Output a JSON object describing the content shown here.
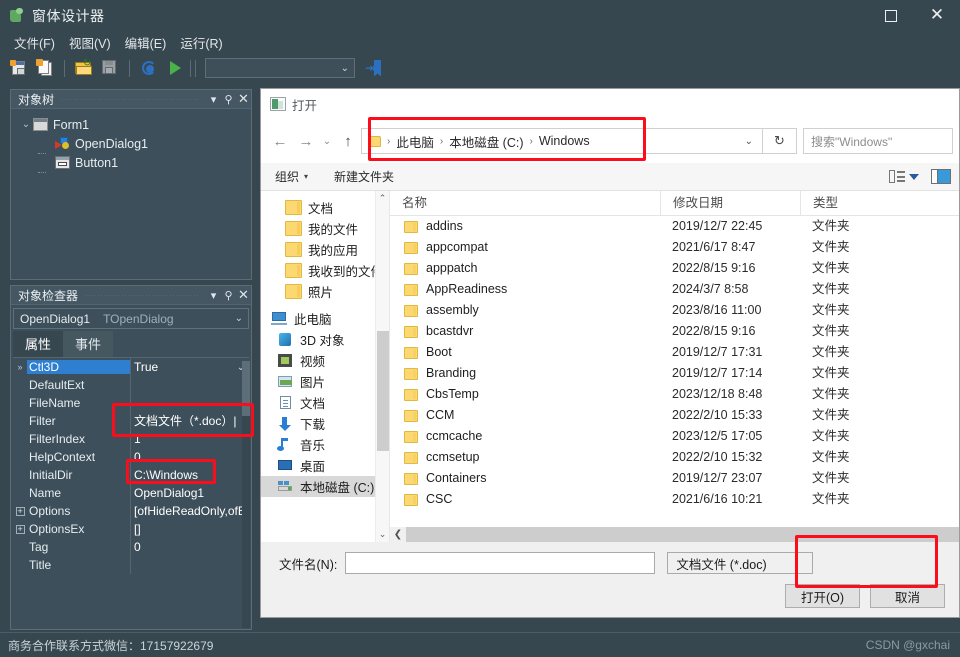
{
  "ide": {
    "title": "窗体设计器",
    "window_buttons": {
      "maximize": "▢",
      "close": "✕"
    },
    "menus": [
      "文件(F)",
      "视图(V)",
      "编辑(E)",
      "运行(R)"
    ],
    "toolbar": {
      "combo_value": "",
      "icons": [
        "new-form-icon",
        "copy-file-icon",
        "open-file-icon",
        "save-file-icon",
        "debug-icon",
        "run-icon",
        "goto-implementation-icon"
      ]
    },
    "statusbar": {
      "text": "商务合作联系方式微信：17157922679"
    },
    "watermark": "CSDN @gxchai"
  },
  "object_tree": {
    "title": "对象树",
    "header_buttons": [
      "▾",
      "⚲",
      "✕"
    ],
    "nodes": [
      {
        "label": "Form1",
        "icon": "form-icon",
        "level": 0,
        "expanded": true
      },
      {
        "label": "OpenDialog1",
        "icon": "open-dialog-icon",
        "level": 1
      },
      {
        "label": "Button1",
        "icon": "button-icon",
        "level": 1
      }
    ]
  },
  "object_inspector": {
    "title": "对象检查器",
    "header_buttons": [
      "▾",
      "⚲",
      "✕"
    ],
    "selector": {
      "object": "OpenDialog1",
      "class": "TOpenDialog"
    },
    "tabs": [
      {
        "label": "属性",
        "active": true
      },
      {
        "label": "事件",
        "active": false
      }
    ],
    "properties": [
      {
        "name": "Ctl3D",
        "value": "True",
        "gutter": "»",
        "selected": true,
        "dropdown": true
      },
      {
        "name": "DefaultExt",
        "value": "",
        "gutter": ""
      },
      {
        "name": "FileName",
        "value": "",
        "gutter": ""
      },
      {
        "name": "Filter",
        "value": "文档文件（*.doc）|",
        "gutter": ""
      },
      {
        "name": "FilterIndex",
        "value": "1",
        "gutter": ""
      },
      {
        "name": "HelpContext",
        "value": "0",
        "gutter": ""
      },
      {
        "name": "InitialDir",
        "value": "C:\\Windows",
        "gutter": ""
      },
      {
        "name": "Name",
        "value": "OpenDialog1",
        "gutter": ""
      },
      {
        "name": "Options",
        "value": "[ofHideReadOnly,ofEnal",
        "gutter": "+"
      },
      {
        "name": "OptionsEx",
        "value": "[]",
        "gutter": "+"
      },
      {
        "name": "Tag",
        "value": "0",
        "gutter": ""
      },
      {
        "name": "Title",
        "value": "",
        "gutter": ""
      }
    ]
  },
  "open_dialog": {
    "title": "打开",
    "nav": {
      "back": "←",
      "forward": "→",
      "history": "⌄",
      "up": "↑",
      "breadcrumb": [
        "此电脑",
        "本地磁盘 (C:)",
        "Windows"
      ],
      "breadcrumb_separator": "›",
      "breadcrumb_chevron": "⌄",
      "refresh": "↻",
      "search_placeholder": "搜索\"Windows\""
    },
    "command_bar": {
      "organize": "组织",
      "organize_caret": "▾",
      "new_folder": "新建文件夹",
      "view_caret": "▾"
    },
    "nav_tree": [
      {
        "label": "文档",
        "icon": "folder-icon",
        "indent": 1
      },
      {
        "label": "我的文件",
        "icon": "folder-icon",
        "indent": 1
      },
      {
        "label": "我的应用",
        "icon": "folder-icon",
        "indent": 1
      },
      {
        "label": "我收到的文件",
        "icon": "folder-icon",
        "indent": 1
      },
      {
        "label": "照片",
        "icon": "folder-icon",
        "indent": 1
      },
      {
        "label": "此电脑",
        "icon": "computer-icon",
        "indent": 0
      },
      {
        "label": "3D 对象",
        "icon": "3d-object-icon",
        "indent": 1
      },
      {
        "label": "视频",
        "icon": "video-icon",
        "indent": 1
      },
      {
        "label": "图片",
        "icon": "picture-icon",
        "indent": 1
      },
      {
        "label": "文档",
        "icon": "document-icon",
        "indent": 1
      },
      {
        "label": "下载",
        "icon": "download-icon",
        "indent": 1
      },
      {
        "label": "音乐",
        "icon": "music-icon",
        "indent": 1
      },
      {
        "label": "桌面",
        "icon": "desktop-icon",
        "indent": 1
      },
      {
        "label": "本地磁盘 (C:)",
        "icon": "disk-icon",
        "indent": 1,
        "selected": true
      }
    ],
    "columns": [
      "名称",
      "修改日期",
      "类型"
    ],
    "files": [
      {
        "name": "addins",
        "date": "2019/12/7 22:45",
        "type": "文件夹"
      },
      {
        "name": "appcompat",
        "date": "2021/6/17 8:47",
        "type": "文件夹"
      },
      {
        "name": "apppatch",
        "date": "2022/8/15 9:16",
        "type": "文件夹"
      },
      {
        "name": "AppReadiness",
        "date": "2024/3/7 8:58",
        "type": "文件夹"
      },
      {
        "name": "assembly",
        "date": "2023/8/16 11:00",
        "type": "文件夹"
      },
      {
        "name": "bcastdvr",
        "date": "2022/8/15 9:16",
        "type": "文件夹"
      },
      {
        "name": "Boot",
        "date": "2019/12/7 17:31",
        "type": "文件夹"
      },
      {
        "name": "Branding",
        "date": "2019/12/7 17:14",
        "type": "文件夹"
      },
      {
        "name": "CbsTemp",
        "date": "2023/12/18 8:48",
        "type": "文件夹"
      },
      {
        "name": "CCM",
        "date": "2022/2/10 15:33",
        "type": "文件夹"
      },
      {
        "name": "ccmcache",
        "date": "2023/12/5 17:05",
        "type": "文件夹"
      },
      {
        "name": "ccmsetup",
        "date": "2022/2/10 15:32",
        "type": "文件夹"
      },
      {
        "name": "Containers",
        "date": "2019/12/7 23:07",
        "type": "文件夹"
      },
      {
        "name": "CSC",
        "date": "2021/6/16 10:21",
        "type": "文件夹"
      }
    ],
    "footer": {
      "filename_label": "文件名(N):",
      "filename_value": "",
      "filter_value": "文档文件 (*.doc)",
      "open_button": "打开(O)",
      "cancel_button": "取消"
    }
  },
  "annotations": {
    "color": "#fc0d1c",
    "boxes": [
      "breadcrumb-highlight",
      "filter-property-highlight",
      "initialdir-property-highlight",
      "filter-combo-highlight"
    ]
  }
}
